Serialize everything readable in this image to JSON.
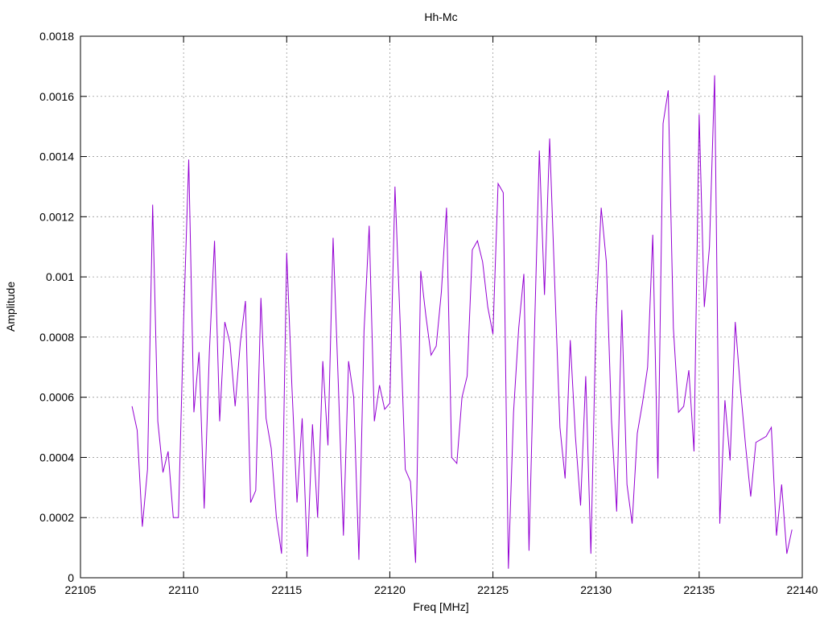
{
  "chart_data": {
    "type": "line",
    "title": "Hh-Mc",
    "xlabel": "Freq [MHz]",
    "ylabel": "Amplitude",
    "xlim": [
      22105,
      22140
    ],
    "ylim": [
      0,
      0.0018
    ],
    "xticks": [
      22105,
      22110,
      22115,
      22120,
      22125,
      22130,
      22135,
      22140
    ],
    "yticks": [
      0,
      0.0002,
      0.0004,
      0.0006,
      0.0008,
      0.001,
      0.0012,
      0.0014,
      0.0016,
      0.0018
    ],
    "xtick_labels": [
      "22105",
      "22110",
      "22115",
      "22120",
      "22125",
      "22130",
      "22135",
      "22140"
    ],
    "ytick_labels": [
      "0",
      "0.0002",
      "0.0004",
      "0.0006",
      "0.0008",
      "0.001",
      "0.0012",
      "0.0014",
      "0.0016",
      "0.0018"
    ],
    "grid": true,
    "color": "#9400d3",
    "series": [
      {
        "x": [
          22107.5,
          22107.75,
          22108.0,
          22108.25,
          22108.5,
          22108.75,
          22109.0,
          22109.25,
          22109.5,
          22109.75,
          22110.0,
          22110.25,
          22110.5,
          22110.75,
          22111.0,
          22111.25,
          22111.5,
          22111.75,
          22112.0,
          22112.25,
          22112.5,
          22112.75,
          22113.0,
          22113.25,
          22113.5,
          22113.75,
          22114.0,
          22114.25,
          22114.5,
          22114.75,
          22115.0,
          22115.25,
          22115.5,
          22115.75,
          22116.0,
          22116.25,
          22116.5,
          22116.75,
          22117.0,
          22117.25,
          22117.5,
          22117.75,
          22118.0,
          22118.25,
          22118.5,
          22118.75,
          22119.0,
          22119.25,
          22119.5,
          22119.75,
          22120.0,
          22120.25,
          22120.5,
          22120.75,
          22121.0,
          22121.25,
          22121.5,
          22121.75,
          22122.0,
          22122.25,
          22122.5,
          22122.75,
          22123.0,
          22123.25,
          22123.5,
          22123.75,
          22124.0,
          22124.25,
          22124.5,
          22124.75,
          22125.0,
          22125.25,
          22125.5,
          22125.75,
          22126.0,
          22126.25,
          22126.5,
          22126.75,
          22127.0,
          22127.25,
          22127.5,
          22127.75,
          22128.0,
          22128.25,
          22128.5,
          22128.75,
          22129.0,
          22129.25,
          22129.5,
          22129.75,
          22130.0,
          22130.25,
          22130.5,
          22130.75,
          22131.0,
          22131.25,
          22131.5,
          22131.75,
          22132.0,
          22132.25,
          22132.5,
          22132.75,
          22133.0,
          22133.25,
          22133.5,
          22133.75,
          22134.0,
          22134.25,
          22134.5,
          22134.75,
          22135.0,
          22135.25,
          22135.5,
          22135.75,
          22136.0,
          22136.25,
          22136.5,
          22136.75,
          22137.0,
          22137.25,
          22137.5,
          22137.75,
          22138.0,
          22138.25,
          22138.5,
          22138.75,
          22139.0,
          22139.25,
          22139.5
        ],
        "y": [
          0.00057,
          0.00049,
          0.00017,
          0.00036,
          0.00124,
          0.00052,
          0.00035,
          0.00042,
          0.0002,
          0.0002,
          0.00085,
          0.00139,
          0.00055,
          0.00075,
          0.00023,
          0.00075,
          0.00112,
          0.00052,
          0.00085,
          0.00078,
          0.00057,
          0.00078,
          0.00092,
          0.00025,
          0.00029,
          0.00093,
          0.00053,
          0.00043,
          0.0002,
          8e-05,
          0.00108,
          0.00064,
          0.00025,
          0.00053,
          7e-05,
          0.00051,
          0.0002,
          0.00072,
          0.00044,
          0.00113,
          0.00065,
          0.00014,
          0.00072,
          0.0006,
          6e-05,
          0.00082,
          0.00117,
          0.00052,
          0.00064,
          0.00056,
          0.00058,
          0.0013,
          0.00085,
          0.00036,
          0.00032,
          5e-05,
          0.00102,
          0.00087,
          0.00074,
          0.00077,
          0.00095,
          0.00123,
          0.0004,
          0.00038,
          0.0006,
          0.00067,
          0.00109,
          0.00112,
          0.00105,
          0.0009,
          0.00081,
          0.00131,
          0.00128,
          3e-05,
          0.00055,
          0.00083,
          0.00101,
          9e-05,
          0.00078,
          0.00142,
          0.00094,
          0.00146,
          0.00097,
          0.0005,
          0.00033,
          0.00079,
          0.00047,
          0.00024,
          0.00067,
          8e-05,
          0.00087,
          0.00123,
          0.00105,
          0.00052,
          0.00022,
          0.00089,
          0.00031,
          0.00018,
          0.00048,
          0.00058,
          0.0007,
          0.00114,
          0.00033,
          0.00151,
          0.00162,
          0.00083,
          0.00055,
          0.00057,
          0.00069,
          0.00042,
          0.00154,
          0.0009,
          0.0011,
          0.00167,
          0.00018,
          0.00059,
          0.00039,
          0.00085,
          0.00063,
          0.00044,
          0.00027,
          0.00045,
          0.00046,
          0.00047,
          0.0005,
          0.00014,
          0.00031,
          8e-05,
          0.00016
        ]
      }
    ]
  }
}
